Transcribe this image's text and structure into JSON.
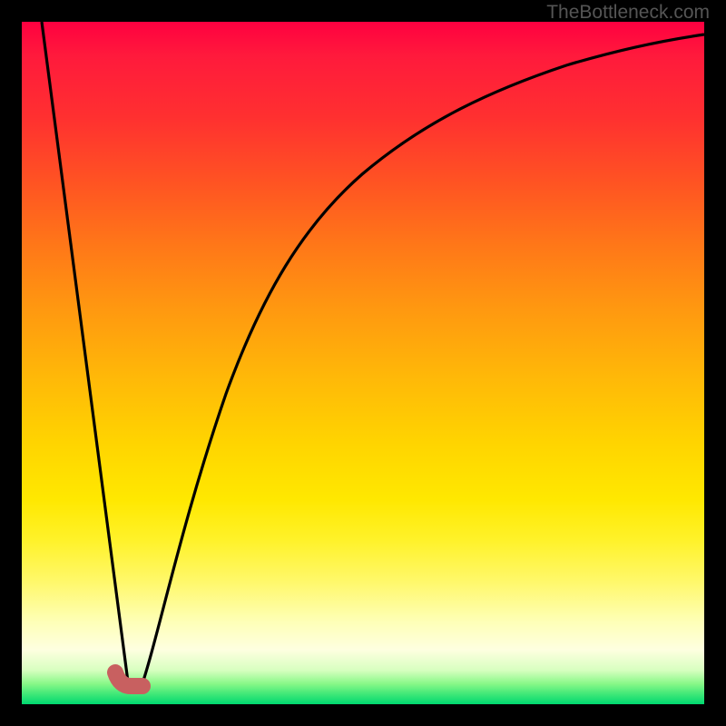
{
  "watermark": "TheBottleneck.com",
  "chart_data": {
    "type": "line",
    "title": "",
    "xlabel": "",
    "ylabel": "",
    "xlim": [
      0,
      100
    ],
    "ylim": [
      0,
      100
    ],
    "grid": false,
    "series": [
      {
        "name": "bottleneck-curve",
        "x": [
          3,
          15.5,
          17.5,
          22,
          30,
          40,
          50,
          60,
          70,
          80,
          90,
          100
        ],
        "y": [
          100,
          2,
          2,
          20,
          45,
          63,
          75,
          83,
          88.5,
          92.5,
          95.5,
          98
        ]
      }
    ],
    "marker": {
      "name": "optimal-segment",
      "x": [
        14,
        17.5
      ],
      "y": [
        3.5,
        3.5
      ]
    },
    "gradient_stops": [
      {
        "pos": 0,
        "color": "#ff0040"
      },
      {
        "pos": 50,
        "color": "#ffaa00"
      },
      {
        "pos": 80,
        "color": "#ffff60"
      },
      {
        "pos": 100,
        "color": "#00d870"
      }
    ]
  }
}
